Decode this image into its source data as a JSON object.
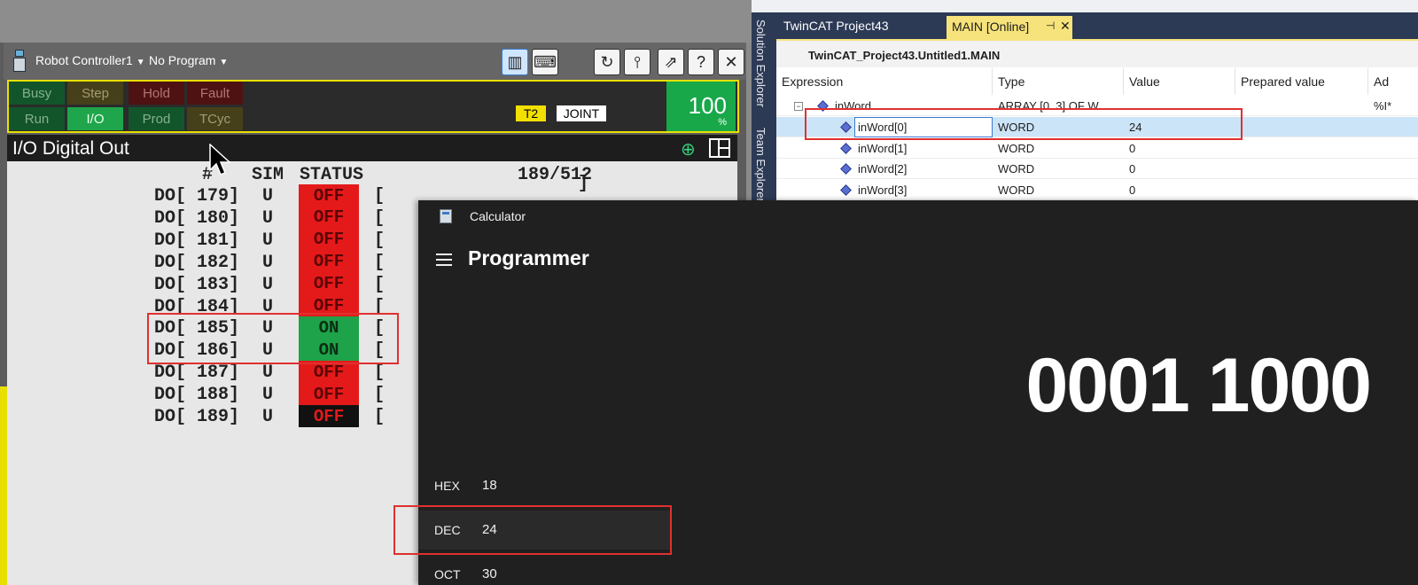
{
  "robot": {
    "controller_label": "Robot Controller1",
    "program_label": "No Program",
    "status_buttons": [
      {
        "label": "Busy"
      },
      {
        "label": "Step"
      },
      {
        "label": "Hold"
      },
      {
        "label": "Fault"
      },
      {
        "label": "Run"
      },
      {
        "label": "I/O"
      },
      {
        "label": "Prod"
      },
      {
        "label": "TCyc"
      }
    ],
    "mode": "T2",
    "coord": "JOINT",
    "override_value": "100",
    "override_unit": "%",
    "screen_title": "I/O Digital Out",
    "header": {
      "hash": "#",
      "sim": "SIM",
      "status": "STATUS",
      "count": "189/512"
    },
    "rows": [
      {
        "label": "DO[ 179]",
        "sim": "U",
        "status": "OFF",
        "bracket": "[",
        "close": "]"
      },
      {
        "label": "DO[ 180]",
        "sim": "U",
        "status": "OFF",
        "bracket": "["
      },
      {
        "label": "DO[ 181]",
        "sim": "U",
        "status": "OFF",
        "bracket": "["
      },
      {
        "label": "DO[ 182]",
        "sim": "U",
        "status": "OFF",
        "bracket": "["
      },
      {
        "label": "DO[ 183]",
        "sim": "U",
        "status": "OFF",
        "bracket": "["
      },
      {
        "label": "DO[ 184]",
        "sim": "U",
        "status": "OFF",
        "bracket": "["
      },
      {
        "label": "DO[ 185]",
        "sim": "U",
        "status": "ON",
        "bracket": "["
      },
      {
        "label": "DO[ 186]",
        "sim": "U",
        "status": "ON",
        "bracket": "["
      },
      {
        "label": "DO[ 187]",
        "sim": "U",
        "status": "OFF",
        "bracket": "["
      },
      {
        "label": "DO[ 188]",
        "sim": "U",
        "status": "OFF",
        "bracket": "["
      },
      {
        "label": "DO[ 189]",
        "sim": "U",
        "status": "OFF",
        "bracket": "["
      }
    ],
    "colors": {
      "on": "#1ea24a",
      "off": "#e41a1a",
      "frame": "#e8e000"
    }
  },
  "twincat": {
    "side_tabs": [
      "Solution Explorer",
      "Team Explorer"
    ],
    "tabs": {
      "project": "TwinCAT Project43",
      "main": "MAIN [Online]",
      "pin": "⊣",
      "close": "✕"
    },
    "path": "TwinCAT_Project43.Untitled1.MAIN",
    "columns": {
      "expression": "Expression",
      "type": "Type",
      "value": "Value",
      "prepared": "Prepared value",
      "address": "Ad"
    },
    "parent": {
      "name": "inWord",
      "type": "ARRAY [0..3] OF W...",
      "address": "%I*",
      "collapse": "−"
    },
    "rows": [
      {
        "name": "inWord[0]",
        "type": "WORD",
        "value": "24"
      },
      {
        "name": "inWord[1]",
        "type": "WORD",
        "value": "0"
      },
      {
        "name": "inWord[2]",
        "type": "WORD",
        "value": "0"
      },
      {
        "name": "inWord[3]",
        "type": "WORD",
        "value": "0"
      }
    ],
    "accent": "#f6e37b"
  },
  "calculator": {
    "title": "Calculator",
    "mode": "Programmer",
    "display": "0001 1000",
    "bases": [
      {
        "name": "HEX",
        "value": "18"
      },
      {
        "name": "DEC",
        "value": "24"
      },
      {
        "name": "OCT",
        "value": "30"
      }
    ]
  }
}
